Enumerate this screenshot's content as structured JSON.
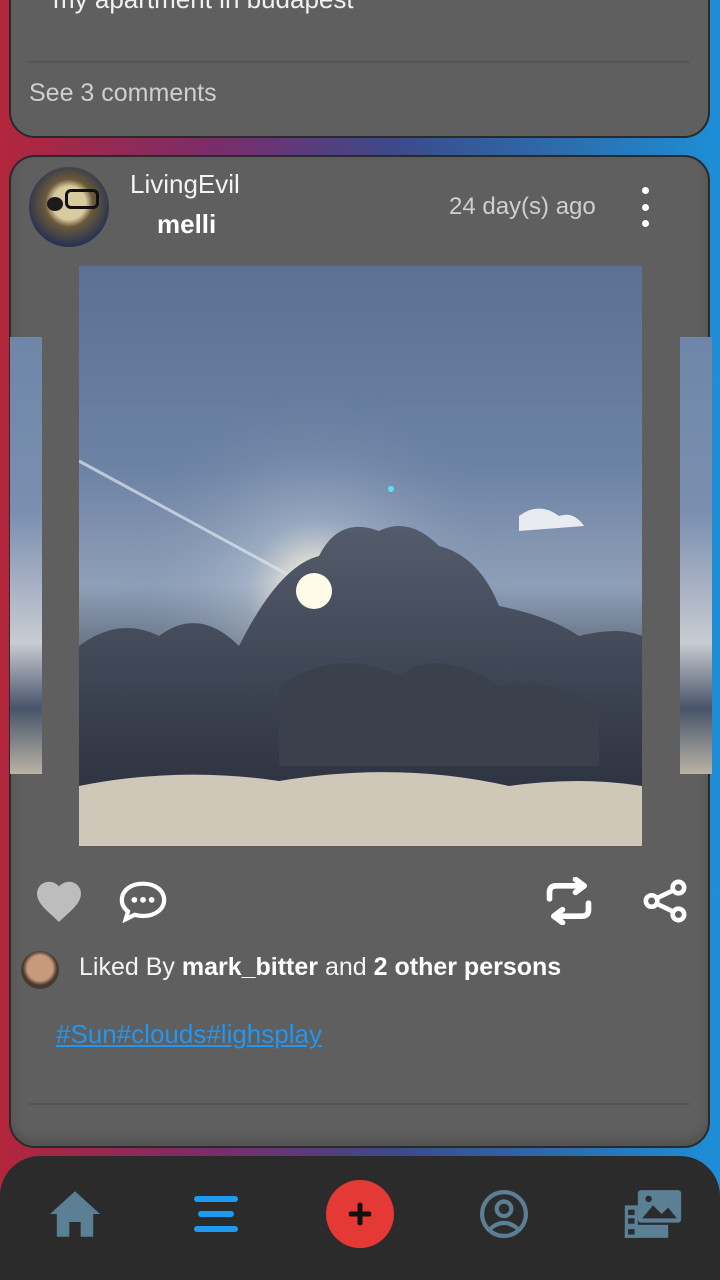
{
  "previous_post": {
    "caption_cutoff": "my apartment in budapest",
    "see_comments": "See 3 comments"
  },
  "post": {
    "username": "LivingEvil",
    "group": "melli",
    "time_ago": "24 day(s) ago",
    "liked_prefix": "Liked By ",
    "liked_user": "mark_bitter",
    "liked_mid": " and ",
    "liked_others": "2 other persons",
    "hashtags": "#Sun#clouds#lighsplay"
  },
  "colors": {
    "accent_blue": "#2196f3",
    "add_button": "#e53935",
    "nav_icon": "#5b7f95"
  },
  "icons": {
    "like": "heart-icon",
    "comment": "comment-icon",
    "repost": "repost-icon",
    "share": "share-icon",
    "more": "more-vertical-icon",
    "nav_home": "home-icon",
    "nav_feed": "menu-icon",
    "nav_add": "add-icon",
    "nav_profile": "profile-icon",
    "nav_gallery": "gallery-icon"
  }
}
